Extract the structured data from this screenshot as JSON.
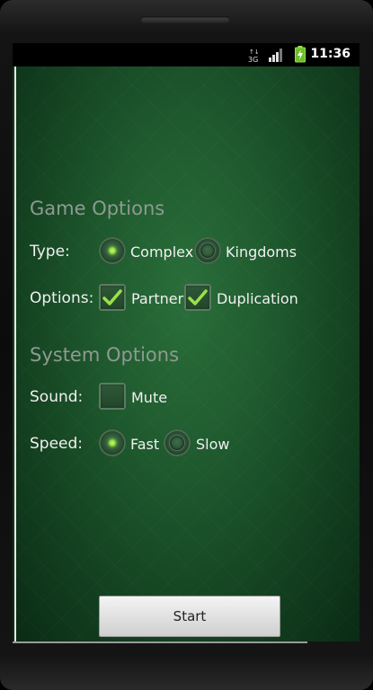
{
  "status_bar": {
    "network_label": "3G",
    "signal_icon": "signal-bars-icon",
    "battery_icon": "battery-charging-icon",
    "time": "11:36"
  },
  "game_options": {
    "title": "Game Options",
    "type_label": "Type:",
    "type_choices": [
      {
        "label": "Complex",
        "selected": true
      },
      {
        "label": "Kingdoms",
        "selected": false
      }
    ],
    "options_label": "Options:",
    "options_choices": [
      {
        "label": "Partner",
        "checked": true
      },
      {
        "label": "Duplication",
        "checked": true
      }
    ]
  },
  "system_options": {
    "title": "System Options",
    "sound_label": "Sound:",
    "sound_choices": [
      {
        "label": "Mute",
        "checked": false
      }
    ],
    "speed_label": "Speed:",
    "speed_choices": [
      {
        "label": "Fast",
        "selected": true
      },
      {
        "label": "Slow",
        "selected": false
      }
    ]
  },
  "start_button": {
    "label": "Start"
  },
  "colors": {
    "background_green": "#1f5a2e",
    "radio_accent": "#7fcf2b",
    "check_accent": "#9be04a"
  }
}
